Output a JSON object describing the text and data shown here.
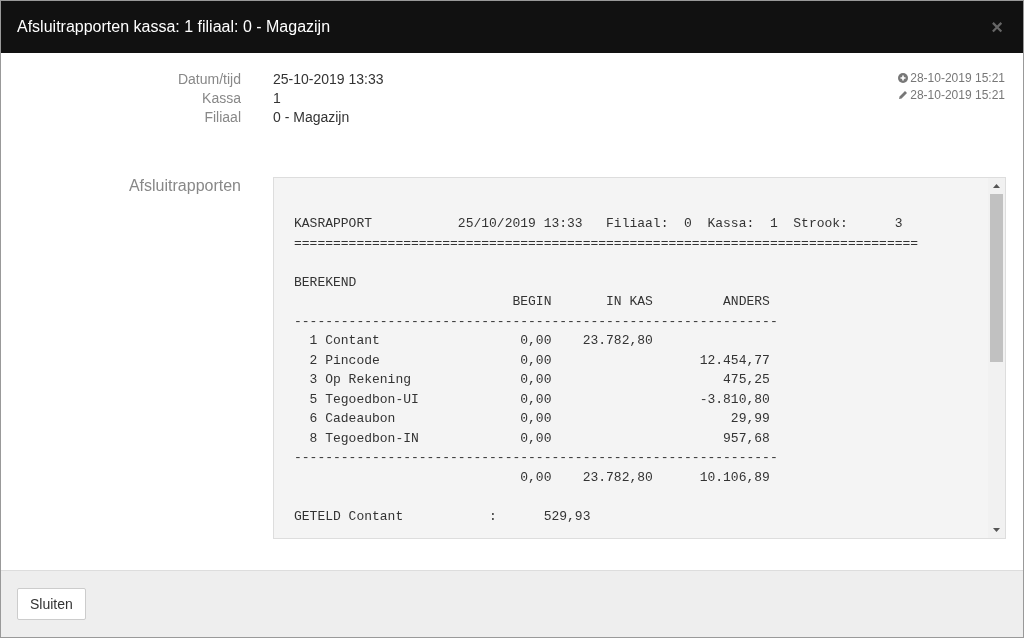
{
  "window": {
    "title": "Afsluitrapporten kassa: 1 filiaal: 0 - Magazijn",
    "close": "×"
  },
  "fields": [
    {
      "label": "Datum/tijd",
      "value": "25-10-2019 13:33"
    },
    {
      "label": "Kassa",
      "value": "1"
    },
    {
      "label": "Filiaal",
      "value": "0 - Magazijn"
    }
  ],
  "meta": [
    {
      "kind": "created",
      "text": "28-10-2019 15:21"
    },
    {
      "kind": "edited",
      "text": "28-10-2019 15:21"
    }
  ],
  "report": {
    "label": "Afsluitrapporten",
    "blocks": [
      [
        "KASRAPPORT           25/10/2019 13:33   Filiaal:  0  Kassa:  1  Strook:      3",
        "================================================================================"
      ],
      [
        "BEREKEND",
        "                            BEGIN       IN KAS         ANDERS",
        "--------------------------------------------------------------",
        "  1 Contant                  0,00    23.782,80",
        "  2 Pincode                  0,00                   12.454,77",
        "  3 Op Rekening              0,00                      475,25",
        "  5 Tegoedbon-UI             0,00                   -3.810,80",
        "  6 Cadeaubon                0,00                       29,99",
        "  8 Tegoedbon-IN             0,00                      957,68",
        "--------------------------------------------------------------",
        "                             0,00    23.782,80      10.106,89"
      ],
      [
        "GETELD Contant           :      529,93"
      ]
    ]
  },
  "footer": {
    "buttons": [
      "Sluiten"
    ]
  }
}
